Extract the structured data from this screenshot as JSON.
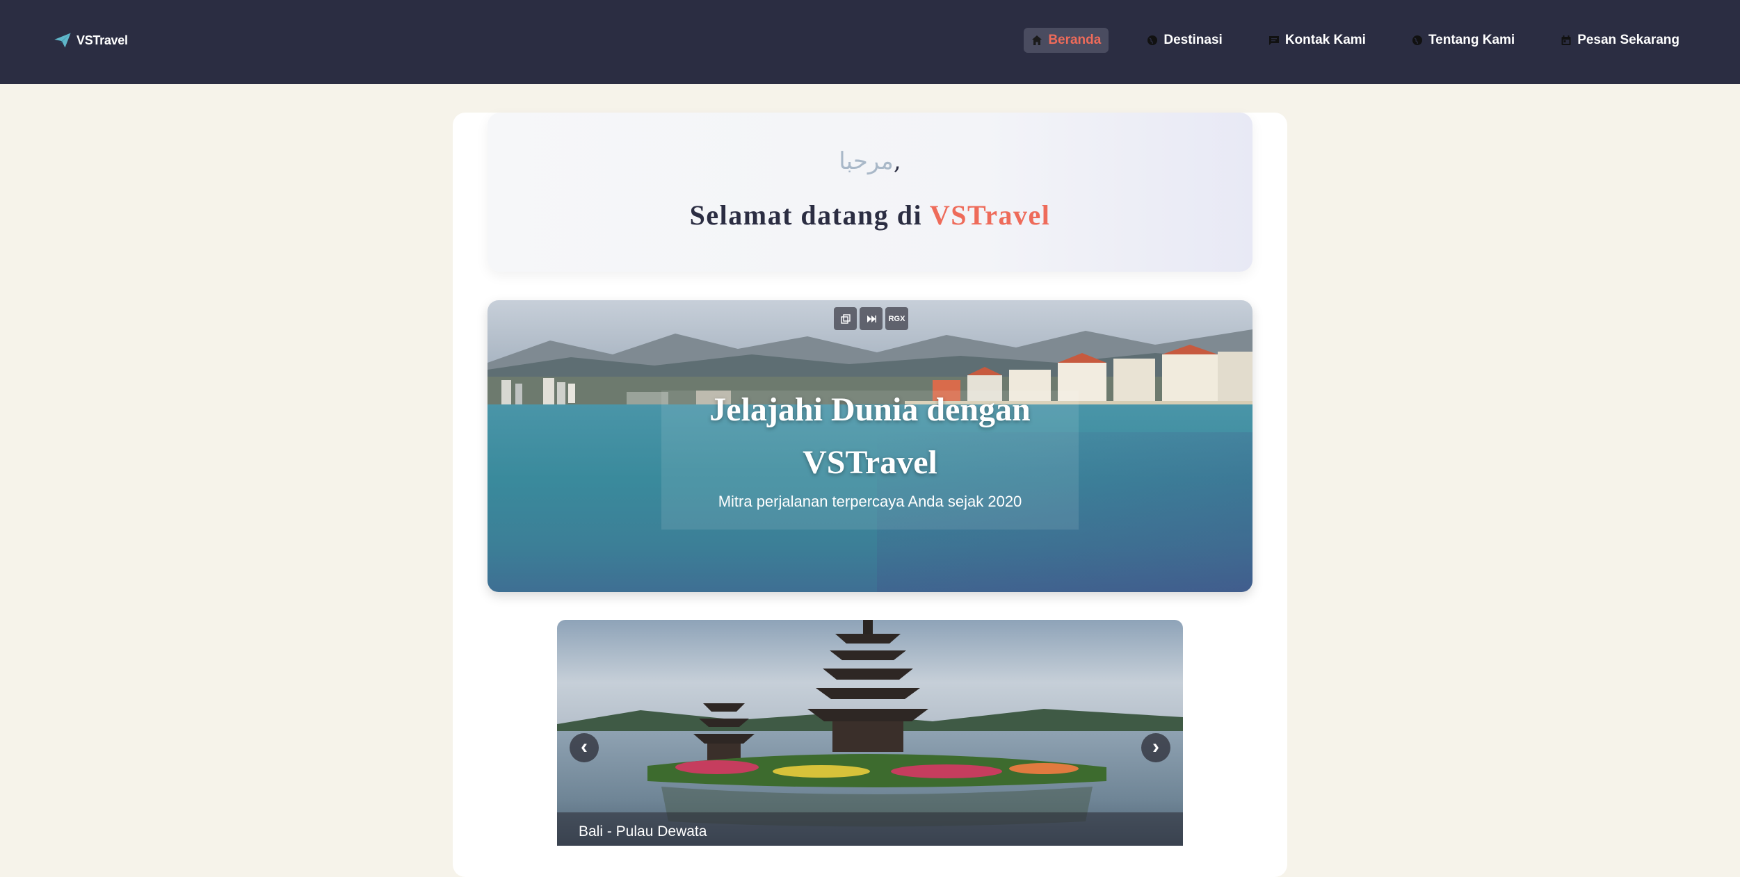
{
  "brand": {
    "name": "VSTravel"
  },
  "nav": {
    "items": [
      {
        "label": "Beranda",
        "icon": "home-icon",
        "active": true
      },
      {
        "label": "Destinasi",
        "icon": "globe-icon"
      },
      {
        "label": "Kontak Kami",
        "icon": "chat-icon"
      },
      {
        "label": "Tentang Kami",
        "icon": "globe-icon"
      },
      {
        "label": "Pesan Sekarang",
        "icon": "calendar-icon"
      }
    ]
  },
  "welcome": {
    "greeting": "مرحبا",
    "greeting_comma": ",",
    "title_prefix": "Selamat datang di ",
    "title_brand": "VSTravel"
  },
  "hero": {
    "title_line1": "Jelajahi Dunia dengan",
    "title_line2": "VSTravel",
    "subtitle": "Mitra perjalanan terpercaya Anda sejak 2020",
    "media_controls": [
      "popout-icon",
      "skip-icon",
      "RGX"
    ]
  },
  "carousel": {
    "caption": "Bali - Pulau Dewata",
    "prev": "‹",
    "next": "›"
  },
  "colors": {
    "navbar": "#2b2d42",
    "accent": "#ee6b5a",
    "background": "#f6f3ea"
  }
}
